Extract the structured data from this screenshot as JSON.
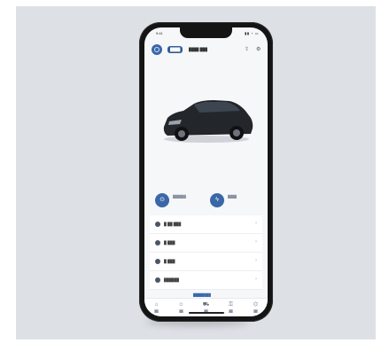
{
  "status_bar": {
    "time": "9:41",
    "icons": "▮▮ ◔ ▭"
  },
  "header": {
    "badge": "████",
    "model_name": "████ ███",
    "icons": [
      {
        "name": "share-icon",
        "glyph": "⇪"
      },
      {
        "name": "settings-icon",
        "glyph": "⚙"
      }
    ]
  },
  "actions": [
    {
      "name": "lock-action",
      "glyph": "⊙",
      "label": "██████"
    },
    {
      "name": "charge-action",
      "glyph": "ϟ",
      "label": "████"
    }
  ],
  "menu": [
    {
      "label": "█ ██ ███"
    },
    {
      "label": "█ ███"
    },
    {
      "label": "█ ███"
    },
    {
      "label": "██████"
    }
  ],
  "more_label": "████████",
  "bottom_nav": [
    {
      "name": "nav-home",
      "glyph": "⌂",
      "label": "██"
    },
    {
      "name": "nav-profile",
      "glyph": "☺",
      "label": "██"
    },
    {
      "name": "nav-car",
      "glyph": "⛟",
      "label": "██"
    },
    {
      "name": "nav-service",
      "glyph": "⚿",
      "label": "██"
    },
    {
      "name": "nav-shop",
      "glyph": "⌬",
      "label": "██"
    }
  ],
  "colors": {
    "accent": "#3a67a8",
    "phone": "#141414",
    "backdrop": "#dde1e6",
    "car": "#23262b"
  }
}
